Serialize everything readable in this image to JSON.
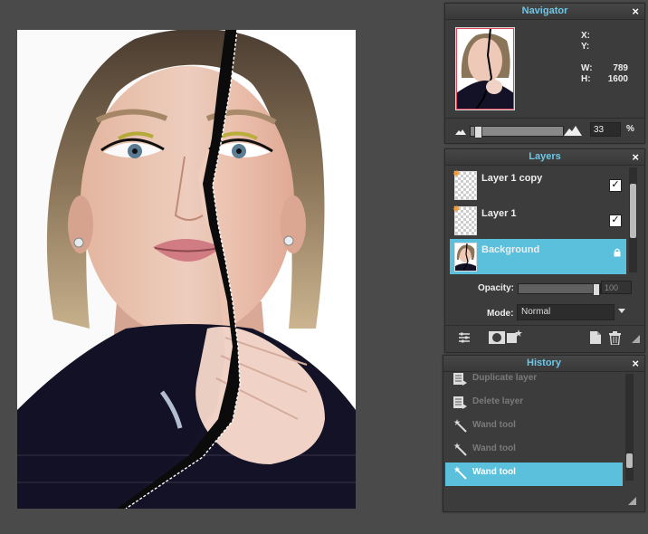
{
  "navigator": {
    "title": "Navigator",
    "close": "×",
    "x_label": "X:",
    "y_label": "Y:",
    "x_value": "",
    "y_value": "",
    "w_label": "W:",
    "h_label": "H:",
    "w_value": "789",
    "h_value": "1600",
    "zoom_value": "33",
    "zoom_unit": "%",
    "zoom_slider_fraction": 0.05
  },
  "layers": {
    "title": "Layers",
    "close": "×",
    "items": [
      {
        "name": "Layer 1 copy",
        "visible": true,
        "selected": false
      },
      {
        "name": "Layer 1",
        "visible": true,
        "selected": false
      },
      {
        "name": "Background",
        "locked": true,
        "selected": true
      }
    ],
    "check_glyph": "✓",
    "lock_glyph": "🔒",
    "opacity_label": "Opacity:",
    "opacity_value": "100",
    "mode_label": "Mode:",
    "mode_value": "Normal"
  },
  "history": {
    "title": "History",
    "close": "×",
    "items": [
      {
        "label": "Duplicate layer",
        "icon": "layer-doc-icon"
      },
      {
        "label": "Delete layer",
        "icon": "layer-doc-icon"
      },
      {
        "label": "Wand tool",
        "icon": "magic-wand-icon"
      },
      {
        "label": "Wand tool",
        "icon": "magic-wand-icon"
      },
      {
        "label": "Wand tool",
        "icon": "magic-wand-icon",
        "selected": true
      }
    ]
  },
  "colors": {
    "accent": "#5bc0dc",
    "panel_bg": "#3c3c3c",
    "title_text": "#6ec6e6",
    "workspace": "#4a4a4a"
  }
}
